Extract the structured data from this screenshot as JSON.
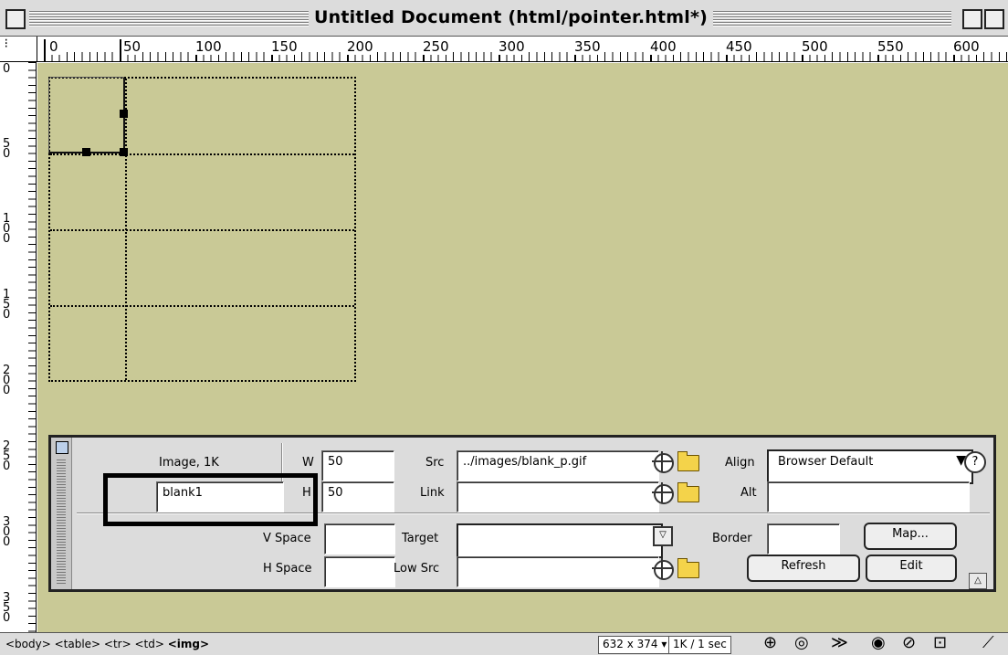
{
  "window": {
    "title": "Untitled Document (html/pointer.html*)"
  },
  "ruler": {
    "horizontal_labels": [
      "0",
      "50",
      "100",
      "150",
      "200",
      "250",
      "300",
      "350",
      "400",
      "450",
      "500",
      "550",
      "600"
    ],
    "vertical_labels": [
      "0",
      "50",
      "100",
      "150",
      "200",
      "250",
      "300",
      "350"
    ]
  },
  "inspector": {
    "type_label": "Image, 1K",
    "name_value": "blank1",
    "w_label": "W",
    "w_value": "50",
    "h_label": "H",
    "h_value": "50",
    "src_label": "Src",
    "src_value": "../images/blank_p.gif",
    "link_label": "Link",
    "link_value": "",
    "align_label": "Align",
    "align_value": "Browser Default",
    "alt_label": "Alt",
    "alt_value": "",
    "vspace_label": "V Space",
    "vspace_value": "",
    "hspace_label": "H Space",
    "hspace_value": "",
    "target_label": "Target",
    "target_value": "",
    "lowsrc_label": "Low Src",
    "lowsrc_value": "",
    "border_label": "Border",
    "border_value": "",
    "map_button": "Map...",
    "refresh_button": "Refresh",
    "edit_button": "Edit",
    "help_glyph": "?"
  },
  "status": {
    "tag_prefix": "<body> <table> <tr> <td> ",
    "tag_current": "<img>",
    "window_size": "632 x 374 ▾",
    "download": "1K / 1 sec"
  },
  "colors": {
    "canvas": "#c9c996",
    "chrome": "#dcdcdc"
  }
}
